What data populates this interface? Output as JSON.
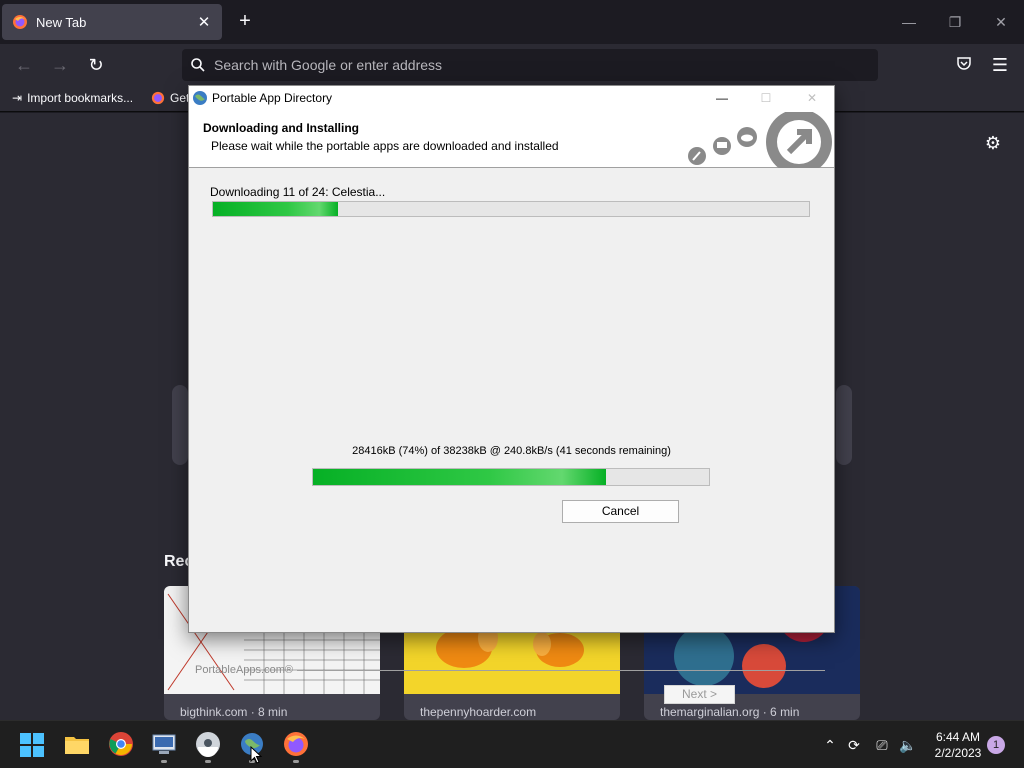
{
  "browser": {
    "tab_title": "New Tab",
    "url_placeholder": "Search with Google or enter address",
    "bookmarks": [
      "Import bookmarks...",
      "Get"
    ]
  },
  "newtab": {
    "recent_heading": "Rec",
    "cards": [
      {
        "caption": "bigthink.com · 8 min"
      },
      {
        "caption": "thepennyhoarder.com"
      },
      {
        "caption": "themarginalian.org · 6 min"
      }
    ]
  },
  "dialog": {
    "title": "Portable App Directory",
    "heading": "Downloading and Installing",
    "subheading": "Please wait while the portable apps are downloaded and installed",
    "status_line": "Downloading 11 of 24: Celestia...",
    "overall_progress": 0.21,
    "transfer_line": "28416kB (74%) of 38238kB @ 240.8kB/s (41 seconds remaining)",
    "file_progress": 0.74,
    "cancel_label": "Cancel",
    "next_label": "Next >",
    "brand": "PortableApps.com®"
  },
  "taskbar": {
    "time": "6:44 AM",
    "date": "2/2/2023",
    "notification_count": "1"
  },
  "colors": {
    "progress_green": "#06b025",
    "browser_bg": "#2b2a33",
    "taskbar_bg": "#1f1f1f"
  }
}
